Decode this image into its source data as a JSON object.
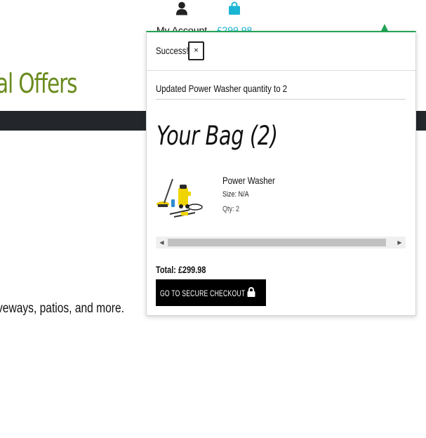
{
  "header": {
    "account_label": "My Account",
    "bag_total": "£299.98",
    "account_icon": "person-icon",
    "bag_icon": "shopping-bag-icon",
    "bag_color": "#1ab5d3"
  },
  "page": {
    "heading_fragment": "al Offers",
    "body_fragment": "veways, patios, and more.",
    "heading_color": "#6a8b1e",
    "bar_color": "#23272b"
  },
  "toast": {
    "title": "Success!",
    "close_label": "×",
    "message": "Updated Power Washer quantity to 2",
    "accent_color": "#23a455"
  },
  "bag": {
    "title": "Your Bag (2)",
    "items": [
      {
        "name": "Power Washer",
        "size": "Size: N/A",
        "qty": "Qty: 2"
      }
    ],
    "total": "Total: £299.98",
    "checkout_label": "Go To Secure Checkout",
    "checkout_icon": "lock-icon"
  }
}
